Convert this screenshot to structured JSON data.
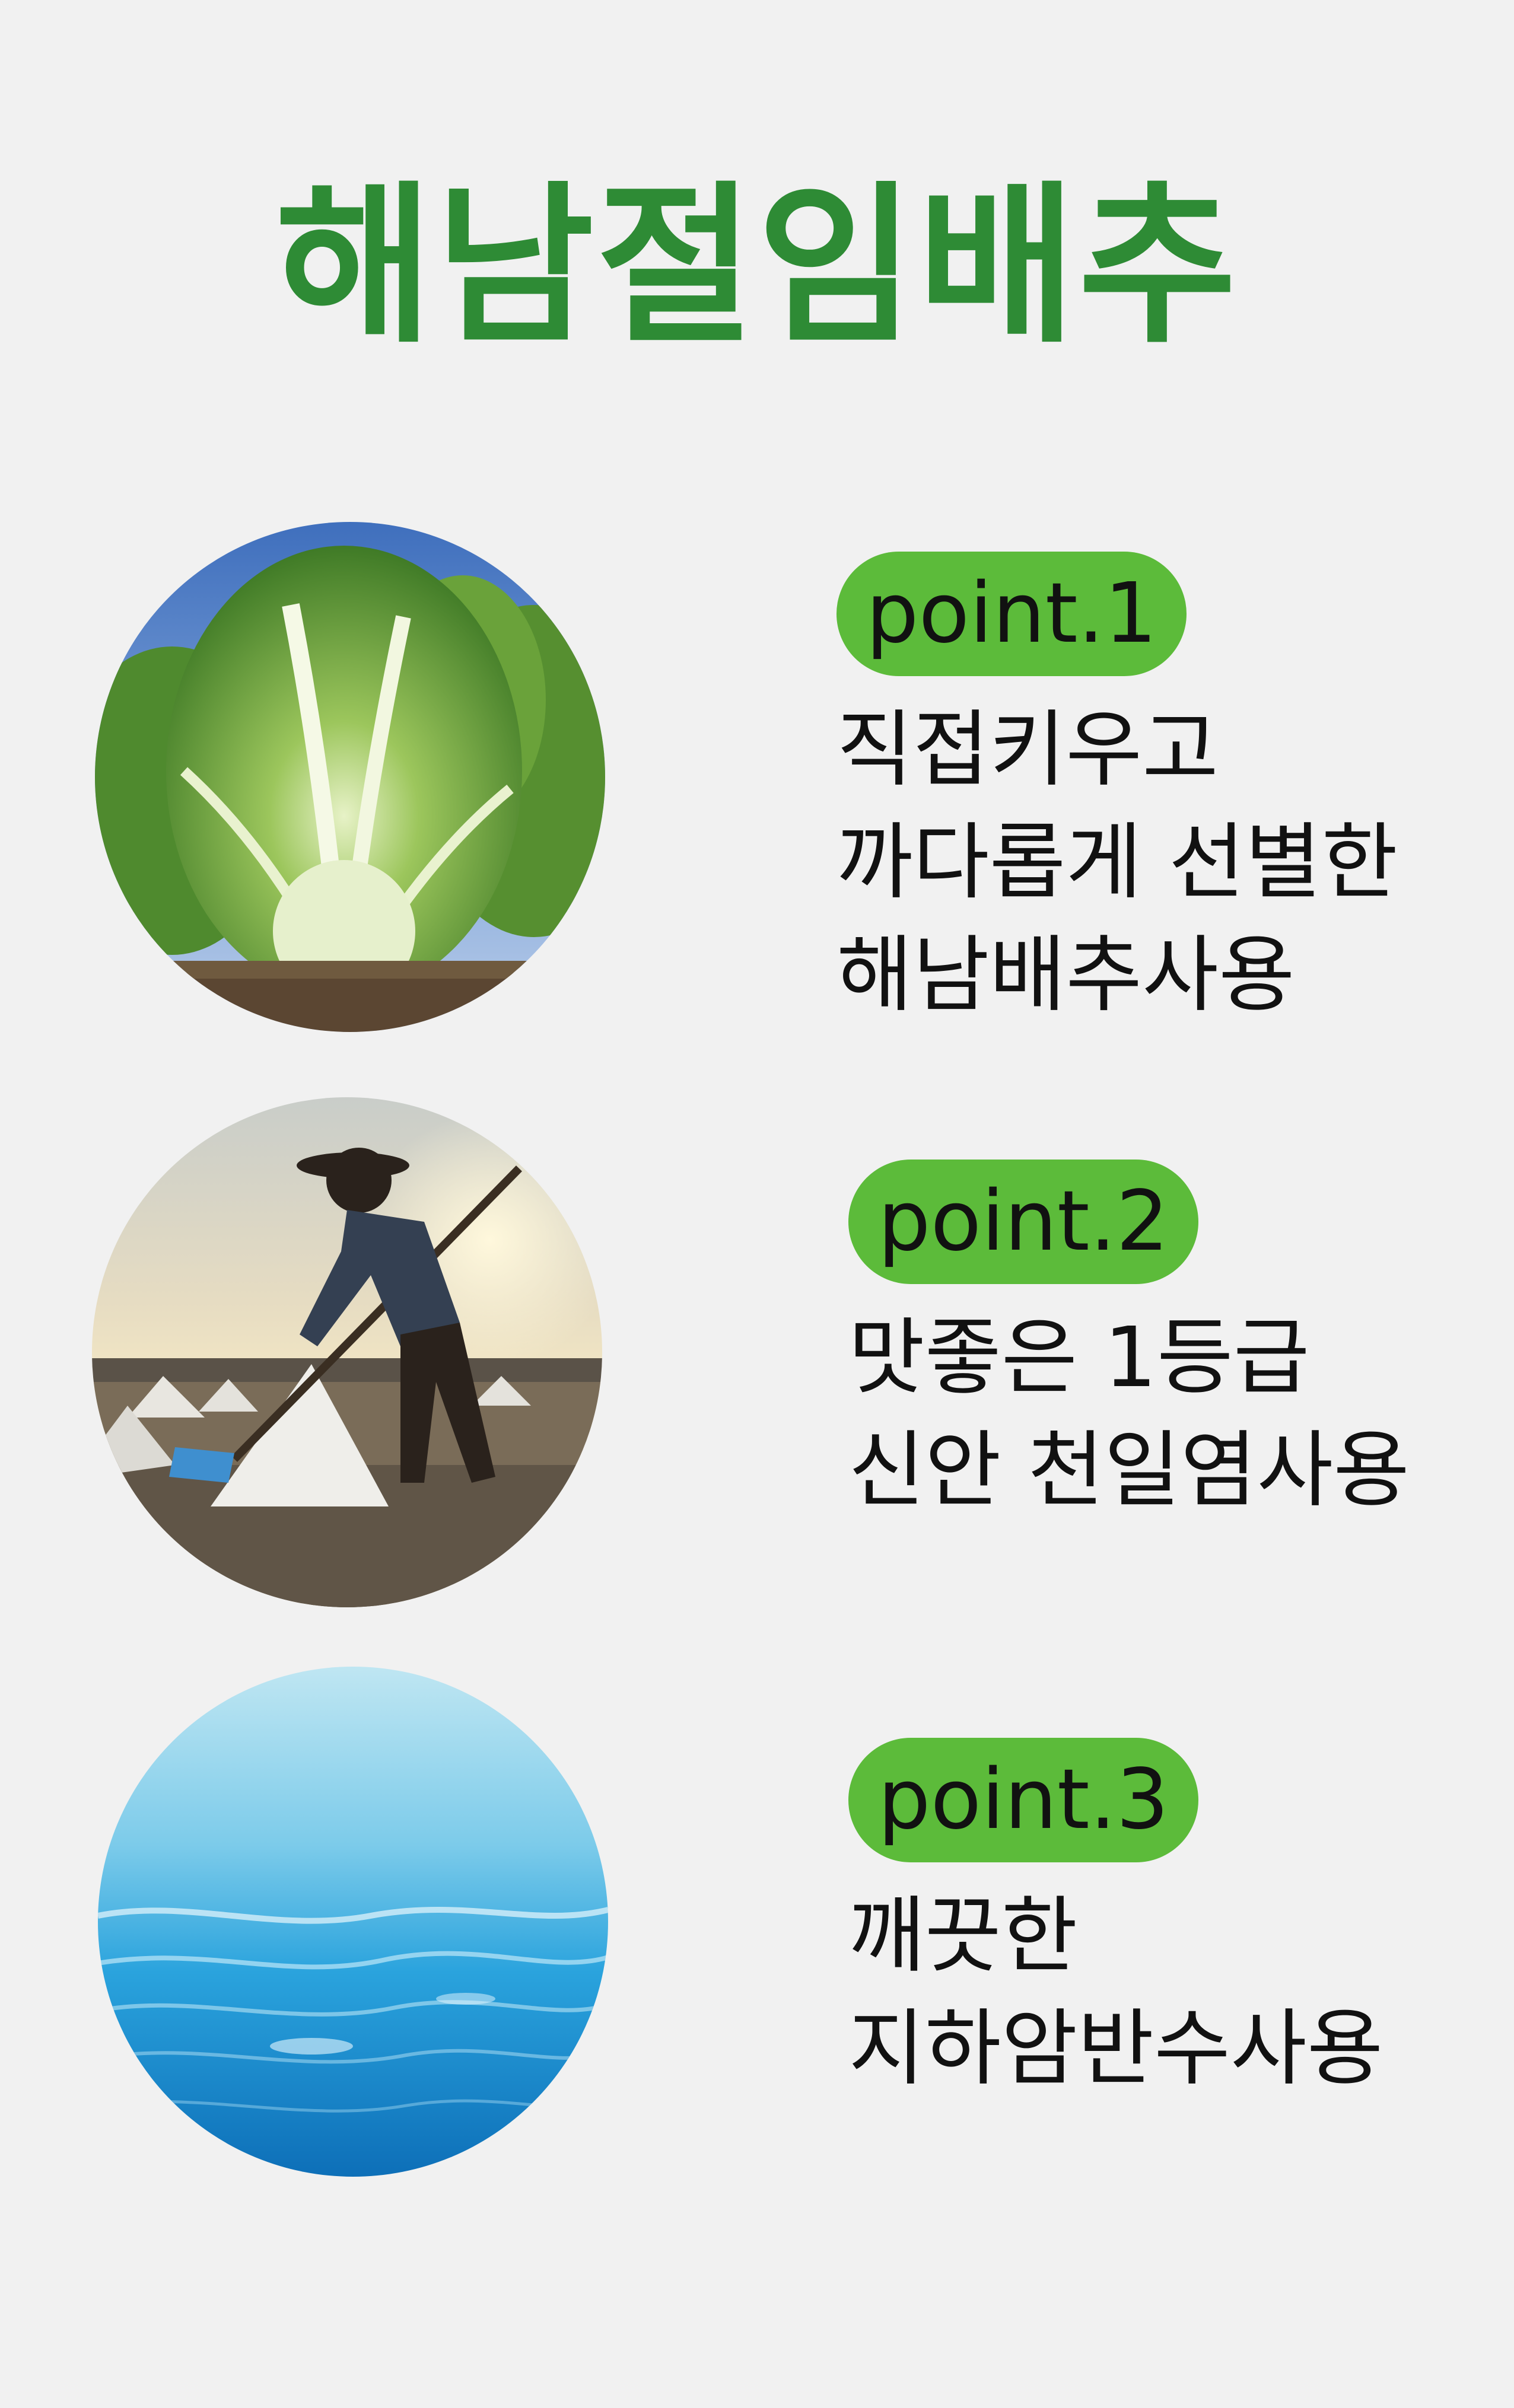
{
  "title": "해남절임배추",
  "points": [
    {
      "badge": "point.1",
      "lines": [
        "직접키우고",
        "까다롭게 선별한",
        "해남배추사용"
      ],
      "image": "napa-cabbage-photo"
    },
    {
      "badge": "point.2",
      "lines": [
        "맛좋은 1등급",
        "신안 천일염사용"
      ],
      "image": "salt-farmer-photo"
    },
    {
      "badge": "point.3",
      "lines": [
        "깨끗한",
        "지하암반수사용"
      ],
      "image": "clear-water-photo"
    }
  ],
  "colors": {
    "background": "#f1f1f1",
    "title": "#2e8b35",
    "badge": "#5cbb3a",
    "text": "#111111"
  }
}
